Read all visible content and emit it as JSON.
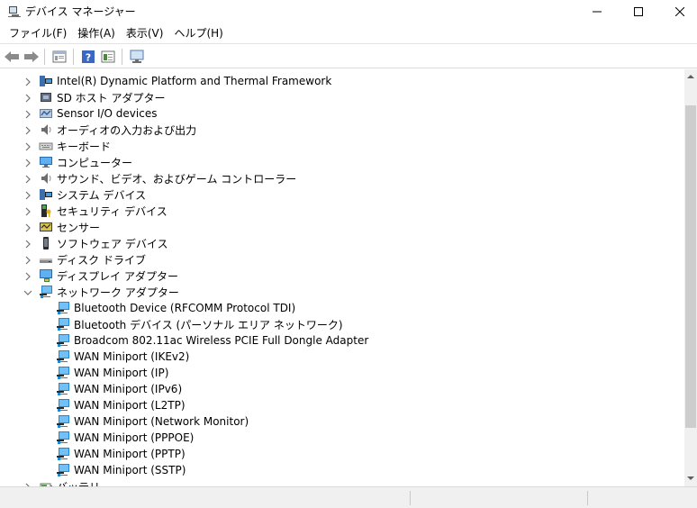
{
  "window": {
    "title": "デバイス マネージャー",
    "icon": "device-manager-icon"
  },
  "menu": [
    "ファイル(F)",
    "操作(A)",
    "表示(V)",
    "ヘルプ(H)"
  ],
  "toolbar": {
    "buttons": [
      "back-arrow-icon",
      "forward-arrow-icon",
      "properties-icon",
      "help-icon",
      "view-icon",
      "monitor-icon"
    ]
  },
  "tree": {
    "categories": [
      {
        "label": "Intel(R) Dynamic Platform and Thermal Framework",
        "icon": "system-device-icon",
        "expanded": false
      },
      {
        "label": "SD ホスト アダプター",
        "icon": "sd-host-icon",
        "expanded": false
      },
      {
        "label": "Sensor I/O devices",
        "icon": "sensor-io-icon",
        "expanded": false
      },
      {
        "label": "オーディオの入力および出力",
        "icon": "speaker-icon",
        "expanded": false
      },
      {
        "label": "キーボード",
        "icon": "keyboard-icon",
        "expanded": false
      },
      {
        "label": "コンピューター",
        "icon": "computer-icon",
        "expanded": false
      },
      {
        "label": "サウンド、ビデオ、およびゲーム コントローラー",
        "icon": "speaker-icon",
        "expanded": false
      },
      {
        "label": "システム デバイス",
        "icon": "system-device-icon",
        "expanded": false
      },
      {
        "label": "セキュリティ デバイス",
        "icon": "security-key-icon",
        "expanded": false
      },
      {
        "label": "センサー",
        "icon": "sensor-icon",
        "expanded": false
      },
      {
        "label": "ソフトウェア デバイス",
        "icon": "phone-icon",
        "expanded": false
      },
      {
        "label": "ディスク ドライブ",
        "icon": "disk-drive-icon",
        "expanded": false
      },
      {
        "label": "ディスプレイ アダプター",
        "icon": "display-adapter-icon",
        "expanded": false
      },
      {
        "label": "ネットワーク アダプター",
        "icon": "network-adapter-icon",
        "expanded": true
      }
    ],
    "network_children": [
      "Bluetooth Device (RFCOMM Protocol TDI)",
      "Bluetooth デバイス (パーソナル エリア ネットワーク)",
      "Broadcom 802.11ac Wireless PCIE Full Dongle Adapter",
      "WAN Miniport (IKEv2)",
      "WAN Miniport (IP)",
      "WAN Miniport (IPv6)",
      "WAN Miniport (L2TP)",
      "WAN Miniport (Network Monitor)",
      "WAN Miniport (PPPOE)",
      "WAN Miniport (PPTP)",
      "WAN Miniport (SSTP)"
    ],
    "partial_next": "バッテリ"
  },
  "colors": {
    "network_blue": "#1e88d8",
    "chevron": "#707070",
    "scroll_thumb": "#cdcdcd"
  }
}
